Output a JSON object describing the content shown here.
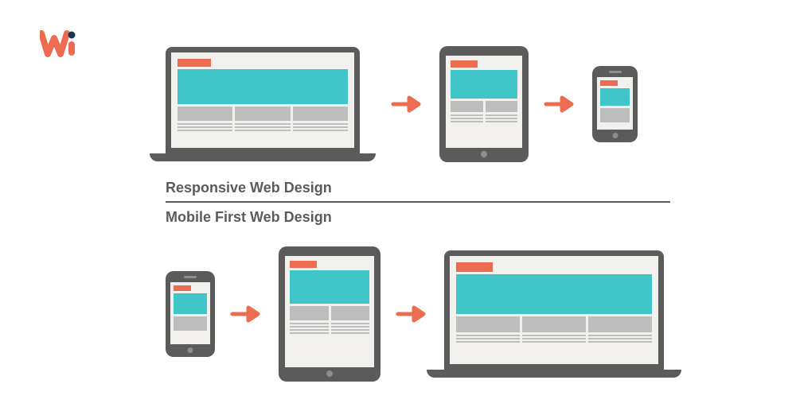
{
  "labels": {
    "responsive": "Responsive Web Design",
    "mobile_first": "Mobile First Web Design"
  },
  "colors": {
    "accent_orange": "#ec6c51",
    "accent_teal": "#40c6c9",
    "frame_gray": "#5b5b5b",
    "block_gray": "#bdbdbd",
    "screen_bg": "#f2f1ed",
    "logo_navy": "#1c3557"
  },
  "flows": {
    "responsive": [
      "laptop",
      "tablet",
      "phone"
    ],
    "mobile_first": [
      "phone",
      "tablet",
      "laptop"
    ]
  }
}
